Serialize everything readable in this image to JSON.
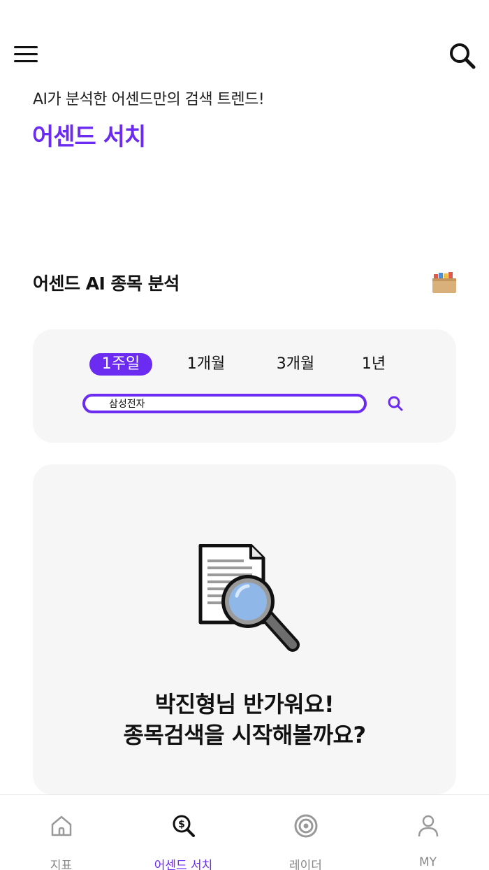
{
  "header": {
    "menu_icon": "hamburger-menu-icon",
    "search_icon": "search-icon"
  },
  "hero": {
    "subtitle": "AI가 분석한 어센드만의 검색 트렌드!",
    "title": "어센드 서치"
  },
  "analysis": {
    "section_title": "어센드 AI 종목 분석",
    "section_icon": "box-icon",
    "periods": [
      {
        "label": "1주일",
        "active": true
      },
      {
        "label": "1개월",
        "active": false
      },
      {
        "label": "3개월",
        "active": false
      },
      {
        "label": "1년",
        "active": false
      }
    ],
    "search_value": "삼성전자",
    "search_icon": "search-icon"
  },
  "welcome": {
    "icon": "document-search-icon",
    "line1": "박진형님 반가워요!",
    "line2": "종목검색을 시작해볼까요?"
  },
  "bottom_nav": {
    "items": [
      {
        "label": "지표",
        "icon": "home-icon",
        "active": false
      },
      {
        "label": "어센드 서치",
        "icon": "dollar-search-icon",
        "active": true
      },
      {
        "label": "레이더",
        "icon": "radar-icon",
        "active": false
      },
      {
        "label": "MY",
        "icon": "person-icon",
        "active": false
      }
    ]
  },
  "colors": {
    "accent": "#6b2bf0",
    "card_bg": "#f6f6f6",
    "nav_inactive": "#888888"
  }
}
